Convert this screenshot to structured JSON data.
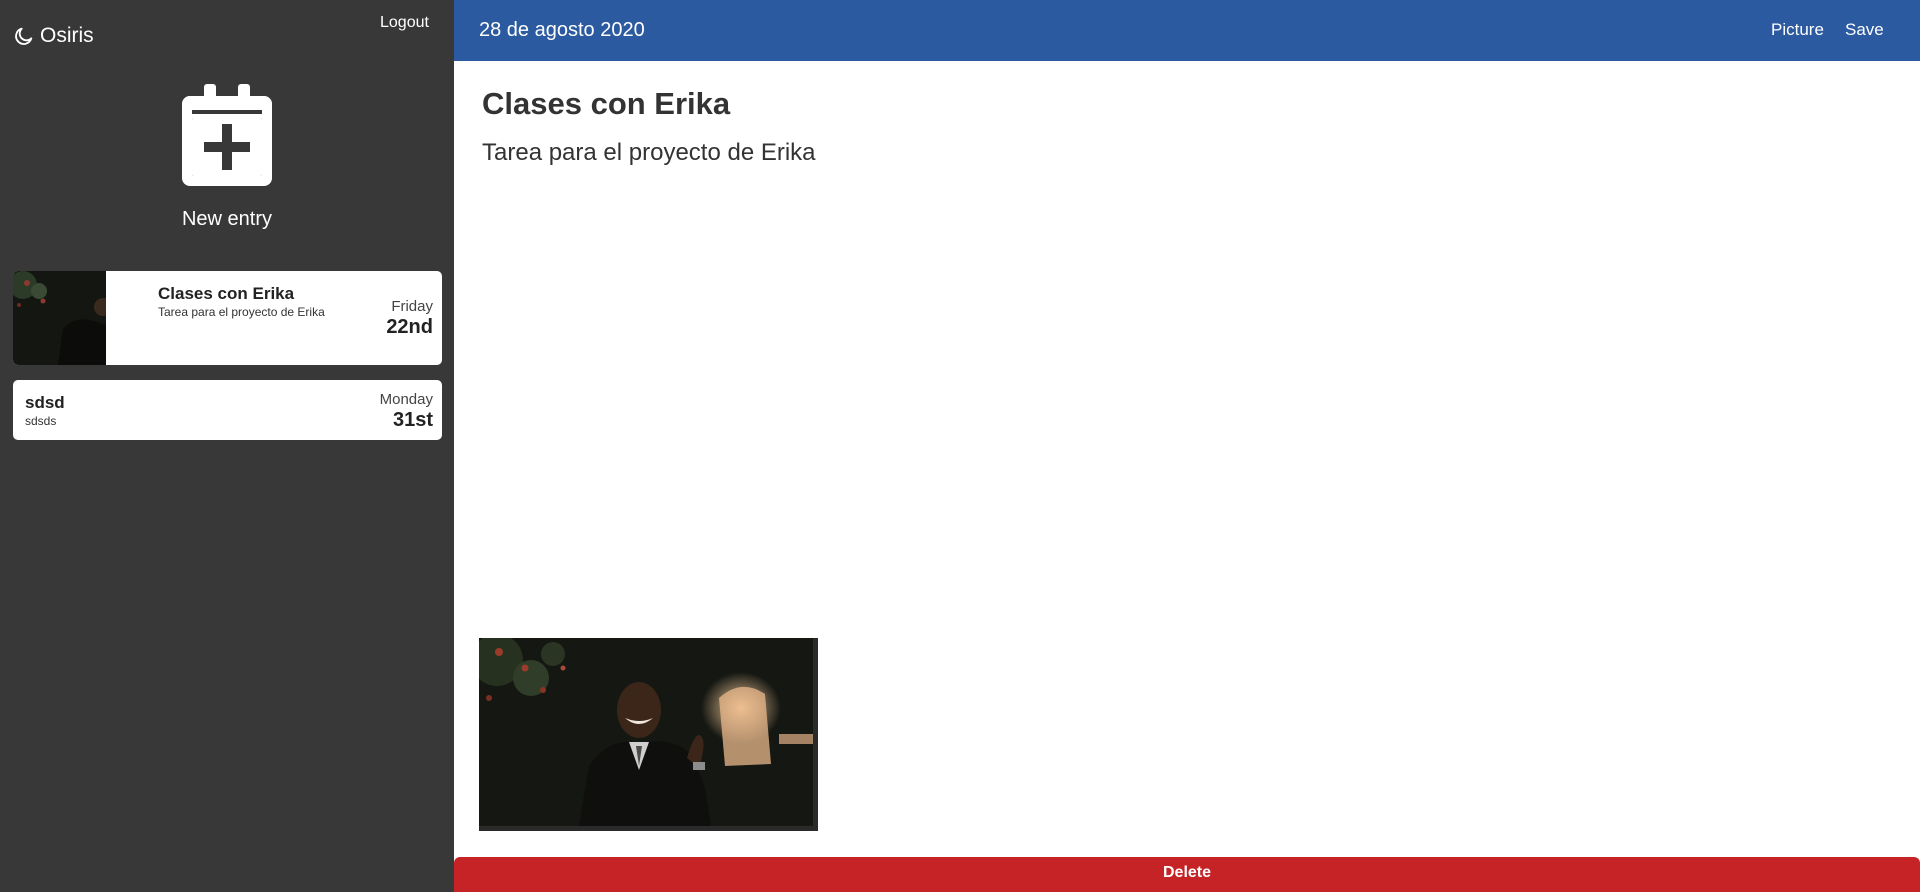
{
  "app": {
    "name": "Osiris",
    "logout_label": "Logout",
    "new_entry_label": "New entry",
    "icons": {
      "brand": "moon-icon",
      "new_entry": "calendar-plus-icon"
    }
  },
  "entries": [
    {
      "title": "Clases con Erika",
      "subtitle": "Tarea para el proyecto de Erika",
      "day": "Friday",
      "date": "22nd",
      "has_thumbnail": true
    },
    {
      "title": "sdsd",
      "subtitle": "sdsds",
      "day": "Monday",
      "date": "31st",
      "has_thumbnail": false
    }
  ],
  "editor": {
    "date": "28 de agosto 2020",
    "picture_label": "Picture",
    "save_label": "Save",
    "title": "Clases con Erika",
    "body": "Tarea para el proyecto de Erika",
    "delete_label": "Delete"
  },
  "colors": {
    "sidebar": "#383838",
    "topbar": "#2c5aa0",
    "delete": "#c62326"
  }
}
